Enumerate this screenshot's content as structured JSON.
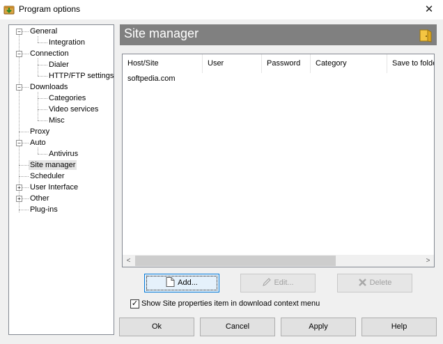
{
  "window": {
    "title": "Program options",
    "close_glyph": "✕"
  },
  "tree": {
    "items": [
      {
        "label": "General",
        "expander": "−"
      },
      {
        "label": "Integration"
      },
      {
        "label": "Connection",
        "expander": "−"
      },
      {
        "label": "Dialer"
      },
      {
        "label": "HTTP/FTP settings"
      },
      {
        "label": "Downloads",
        "expander": "−"
      },
      {
        "label": "Categories"
      },
      {
        "label": "Video services"
      },
      {
        "label": "Misc"
      },
      {
        "label": "Proxy"
      },
      {
        "label": "Auto",
        "expander": "−"
      },
      {
        "label": "Antivirus"
      },
      {
        "label": "Site manager",
        "selected": true
      },
      {
        "label": "Scheduler"
      },
      {
        "label": "User Interface",
        "expander": "+"
      },
      {
        "label": "Other",
        "expander": "+"
      },
      {
        "label": "Plug-ins"
      }
    ]
  },
  "header": {
    "title": "Site manager"
  },
  "table": {
    "columns": [
      "Host/Site",
      "User",
      "Password",
      "Category",
      "Save to folder"
    ],
    "rows": [
      [
        "softpedia.com",
        "",
        "",
        "",
        ""
      ]
    ]
  },
  "scrollbar": {
    "left_arrow": "<",
    "right_arrow": ">"
  },
  "actions": {
    "add": "Add...",
    "edit": "Edit...",
    "delete": "Delete"
  },
  "option": {
    "label": "Show Site properties item in download context menu",
    "checked": true,
    "check_glyph": "✓"
  },
  "footer": {
    "ok": "Ok",
    "cancel": "Cancel",
    "apply": "Apply",
    "help": "Help"
  }
}
